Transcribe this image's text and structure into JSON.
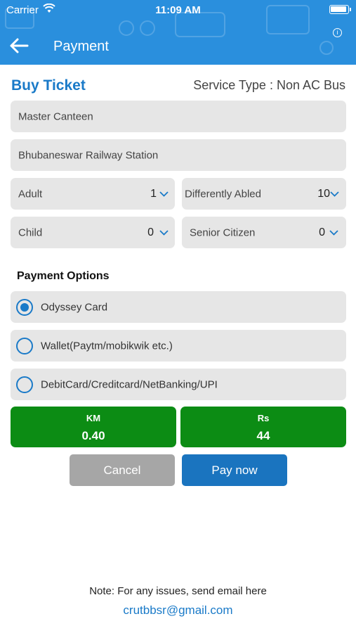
{
  "status_bar": {
    "carrier": "Carrier",
    "time": "11:09 AM"
  },
  "header": {
    "title": "Payment"
  },
  "ticket": {
    "heading": "Buy Ticket",
    "service_type": "Service Type : Non AC Bus"
  },
  "route": {
    "from": "Master Canteen",
    "to": "Bhubaneswar Railway Station"
  },
  "passengers": {
    "adult": {
      "label": "Adult",
      "count": "1"
    },
    "differently_abled": {
      "label": "Differently Abled",
      "count": "10"
    },
    "child": {
      "label": "Child",
      "count": "0"
    },
    "senior_citizen": {
      "label": "Senior Citizen",
      "count": "0"
    }
  },
  "payment": {
    "heading": "Payment Options",
    "options": [
      {
        "label": "Odyssey Card",
        "selected": true
      },
      {
        "label": "Wallet(Paytm/mobikwik etc.)",
        "selected": false
      },
      {
        "label": "DebitCard/Creditcard/NetBanking/UPI",
        "selected": false
      }
    ]
  },
  "fare": {
    "km_label": "KM",
    "km_value": "0.40",
    "rs_label": "Rs",
    "rs_value": "44"
  },
  "buttons": {
    "cancel": "Cancel",
    "pay": "Pay now"
  },
  "footer": {
    "note": "Note: For any issues, send email here",
    "email": "crutbbsr@gmail.com"
  },
  "colors": {
    "header_bg": "#2a8fdd",
    "accent": "#1a7ac8",
    "fare_bg": "#0c8c14",
    "cancel_bg": "#a6a6a6",
    "pay_bg": "#1a74bf"
  },
  "icons": [
    "wifi-icon",
    "battery-icon",
    "info-icon",
    "back-arrow-icon",
    "chevron-down-icon",
    "radio-icon"
  ]
}
